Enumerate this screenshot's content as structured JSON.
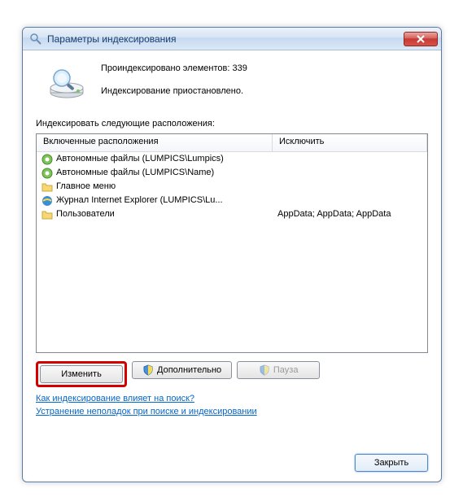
{
  "window": {
    "title": "Параметры индексирования"
  },
  "status": {
    "indexed_label": "Проиндексировано элементов:",
    "indexed_count": "339",
    "paused": "Индексирование приостановлено."
  },
  "section_label": "Индексировать следующие расположения:",
  "columns": {
    "included": "Включенные расположения",
    "exclude": "Исключить"
  },
  "rows": [
    {
      "icon": "offline",
      "label": "Автономные файлы (LUMPICS\\Lumpics)",
      "exclude": ""
    },
    {
      "icon": "offline",
      "label": "Автономные файлы (LUMPICS\\Name)",
      "exclude": ""
    },
    {
      "icon": "folder",
      "label": "Главное меню",
      "exclude": ""
    },
    {
      "icon": "ie",
      "label": "Журнал Internet Explorer (LUMPICS\\Lu...",
      "exclude": ""
    },
    {
      "icon": "folder",
      "label": "Пользователи",
      "exclude": "AppData; AppData; AppData"
    }
  ],
  "buttons": {
    "modify": "Изменить",
    "advanced": "Дополнительно",
    "pause": "Пауза",
    "close": "Закрыть"
  },
  "links": {
    "how_affects": "Как индексирование влияет на поиск?",
    "troubleshoot": "Устранение неполадок при поиске и индексировании"
  }
}
